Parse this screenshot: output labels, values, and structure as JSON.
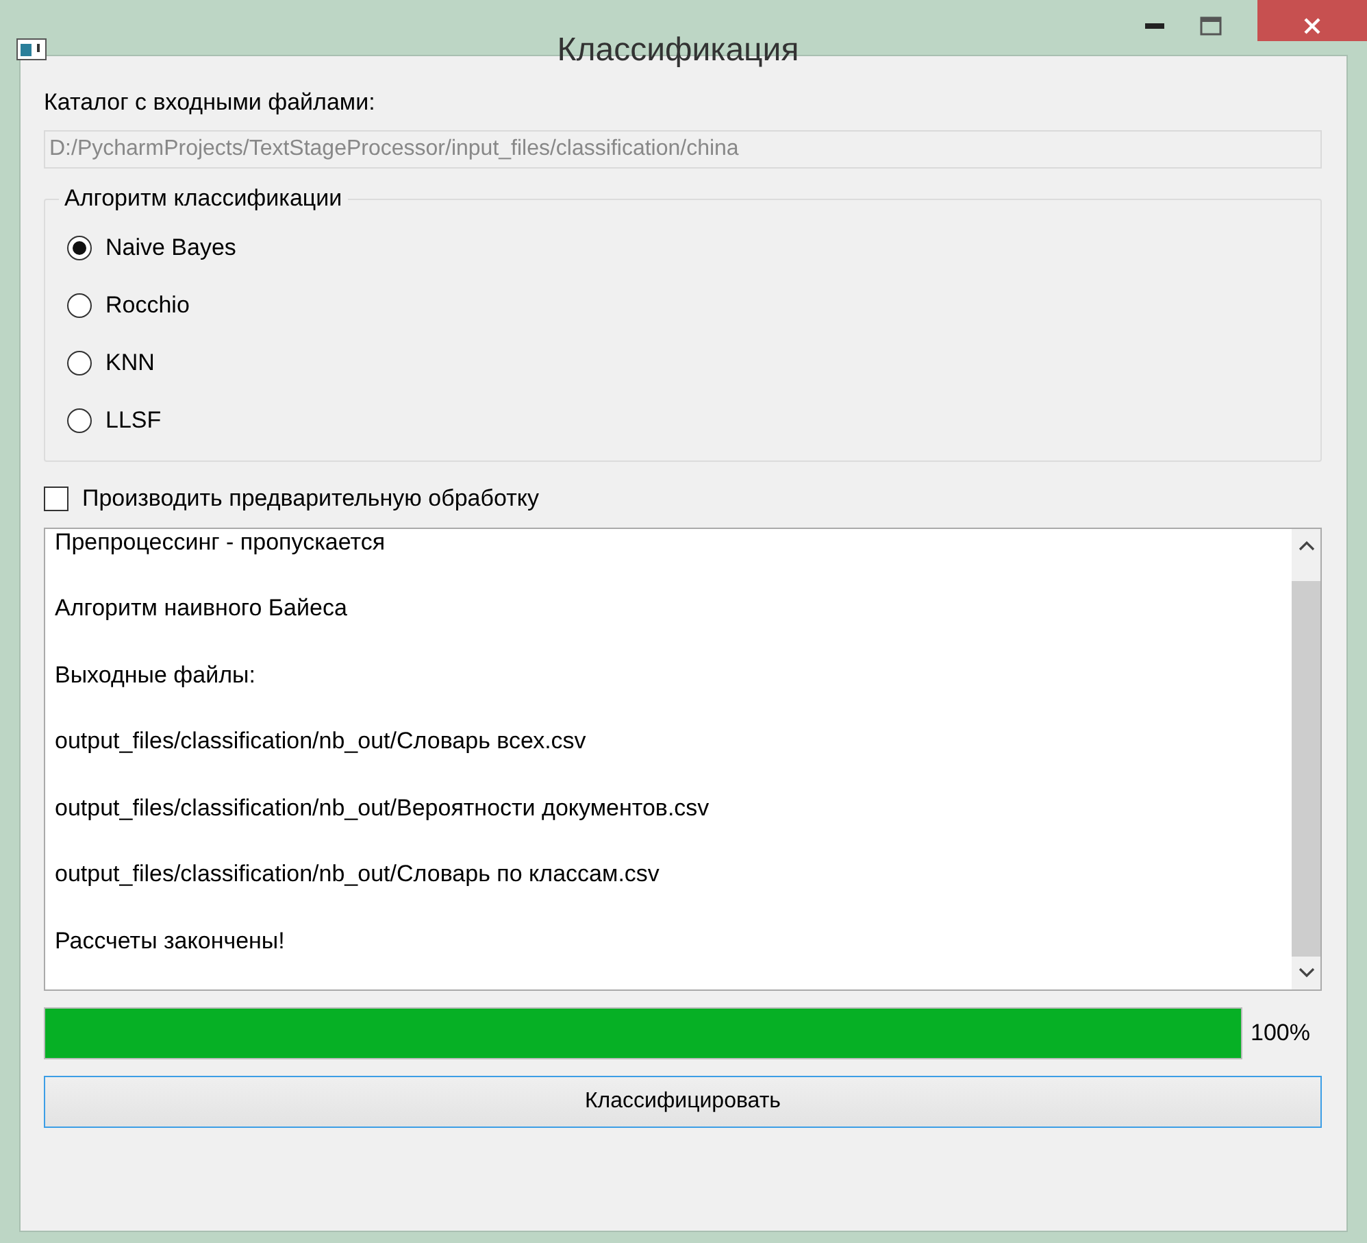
{
  "window": {
    "title": "Классификация"
  },
  "input_dir": {
    "label": "Каталог с входными файлами:",
    "value": "D:/PycharmProjects/TextStageProcessor/input_files/classification/china",
    "disabled": true
  },
  "algorithm_group": {
    "title": "Алгоритм классификации",
    "options": [
      {
        "label": "Naive Bayes",
        "selected": true
      },
      {
        "label": "Rocchio",
        "selected": false
      },
      {
        "label": "KNN",
        "selected": false
      },
      {
        "label": "LLSF",
        "selected": false
      }
    ]
  },
  "preprocess": {
    "label": "Производить предварительную обработку",
    "checked": false
  },
  "log": {
    "lines": [
      "Препроцессинг - пропускается",
      "Алгоритм наивного Байеса",
      "Выходные файлы:",
      "output_files/classification/nb_out/Словарь всех.csv",
      "output_files/classification/nb_out/Вероятности документов.csv",
      "output_files/classification/nb_out/Словарь по классам.csv",
      "Рассчеты закончены!"
    ]
  },
  "progress": {
    "level": 1,
    "reading": "100%"
  },
  "button": {
    "label": "Классифицировать"
  }
}
